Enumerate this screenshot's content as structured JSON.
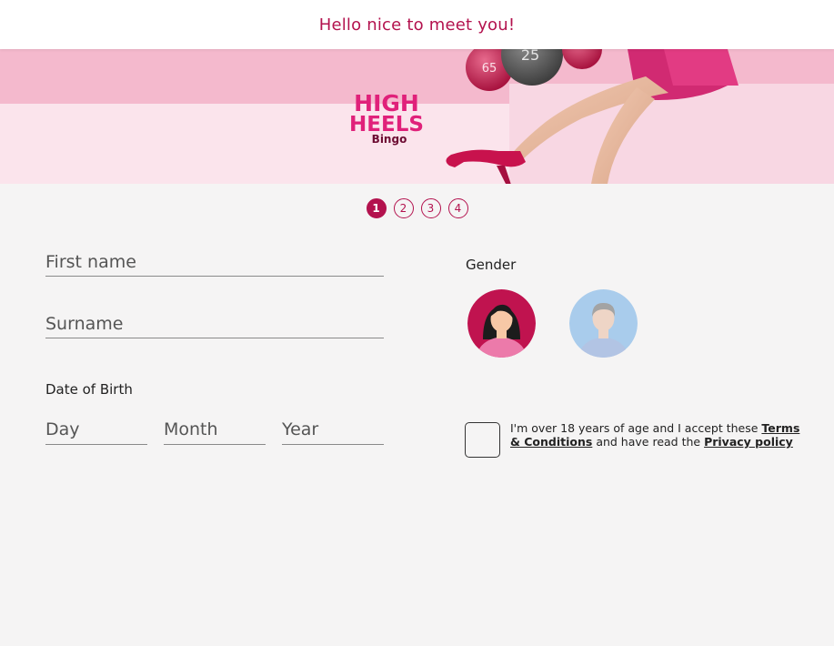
{
  "header": {
    "title": "Hello nice to meet you!"
  },
  "banner": {
    "logo_line1": "HIGH",
    "logo_line2": "HEELS",
    "logo_line3": "Bingo",
    "ball_numbers": [
      "65",
      "25"
    ]
  },
  "steps": [
    "1",
    "2",
    "3",
    "4"
  ],
  "active_step": 1,
  "form": {
    "first_name_placeholder": "First name",
    "surname_placeholder": "Surname",
    "dob_label": "Date of Birth",
    "day_placeholder": "Day",
    "month_placeholder": "Month",
    "year_placeholder": "Year",
    "gender_label": "Gender"
  },
  "consent": {
    "text_before": "I'm over 18 years of age and I accept these ",
    "terms_link": "Terms & Conditions",
    "text_middle": " and have read the ",
    "privacy_link": "Privacy policy"
  },
  "colors": {
    "brand": "#b3124e",
    "female_bg": "#c0134f",
    "male_bg": "#a9ccec"
  },
  "icons": {
    "female_avatar": "female-avatar-icon",
    "male_avatar": "male-avatar-icon"
  }
}
